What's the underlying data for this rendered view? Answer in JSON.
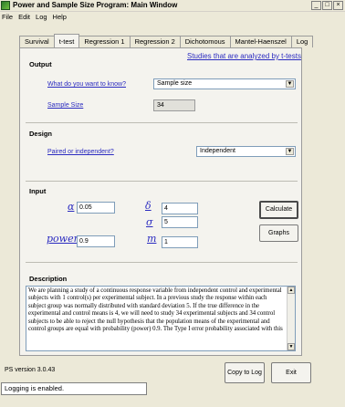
{
  "window": {
    "title": "Power and Sample Size Program:  Main Window",
    "min": "_",
    "max": "□",
    "close": "×"
  },
  "menu": [
    "File",
    "Edit",
    "Log",
    "Help"
  ],
  "tabs": [
    "Survival",
    "t-test",
    "Regression 1",
    "Regression 2",
    "Dichotomous",
    "Mantel-Haenszel",
    "Log"
  ],
  "output": {
    "title": "Output",
    "studies_link": "Studies that are analyzed by t-tests",
    "what_label": "What do you want to know?",
    "what_value": "Sample size",
    "sample_size_label": "Sample Size",
    "sample_size_value": "34"
  },
  "design": {
    "title": "Design",
    "paired_label": "Paired or independent?",
    "paired_value": "Independent"
  },
  "input": {
    "title": "Input",
    "alpha_symbol": "α",
    "alpha_value": "0.05",
    "delta_symbol": "δ",
    "delta_value": "4",
    "sigma_symbol": "σ",
    "sigma_value": "5",
    "power_symbol": "power",
    "power_value": "0.9",
    "m_symbol": "m",
    "m_value": "1",
    "calculate_label": "Calculate",
    "graphs_label": "Graphs"
  },
  "description": {
    "title": "Description",
    "text": "We are planning a study of a continuous response variable from independent control and experimental subjects with 1 control(s) per experimental subject.  In a previous study the response within each subject group was normally distributed with standard deviation 5.  If the true difference in the experimental and control means is 4, we will need to study 34 experimental subjects and 34 control subjects to be able to reject the null hypothesis that the population means of the experimental and control groups are equal with probability (power) 0.9.  The Type I error probability associated with this"
  },
  "footer": {
    "version": "PS version 3.0.43",
    "copy_label": "Copy to Log",
    "exit_label": "Exit",
    "status": "Logging is enabled."
  }
}
